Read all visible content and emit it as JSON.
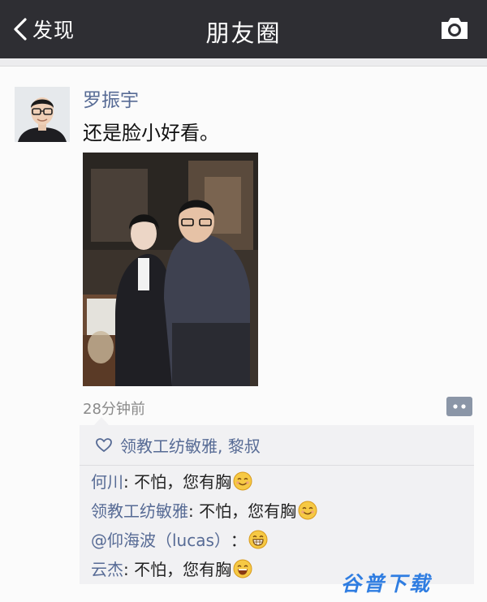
{
  "navbar": {
    "back_label": "发现",
    "title": "朋友圈",
    "back_icon": "chevron-left-icon",
    "camera_icon": "camera-icon"
  },
  "post": {
    "author": "罗振宇",
    "text": "还是脸小好看。",
    "time": "28分钟前"
  },
  "likes": {
    "icon": "heart-outline-icon",
    "names": "领教工纺敏雅, 黎叔"
  },
  "comments": [
    {
      "author": "何川",
      "text": ": 不怕，您有胸",
      "emoji": "smile-emoji"
    },
    {
      "author": "领教工纺敏雅",
      "text": ": 不怕，您有胸",
      "emoji": "smile-emoji"
    },
    {
      "author": "@仰海波（lucas）",
      "text": "：",
      "emoji": "grin-emoji"
    },
    {
      "author": "云杰",
      "text": ": 不怕，您有胸",
      "emoji": "laugh-emoji"
    }
  ],
  "watermark": "谷普下载",
  "colors": {
    "navbar": "#2e2e33",
    "link": "#576b95",
    "feedback_bg": "#f1f1f3",
    "watermark": "#2f7de1"
  }
}
